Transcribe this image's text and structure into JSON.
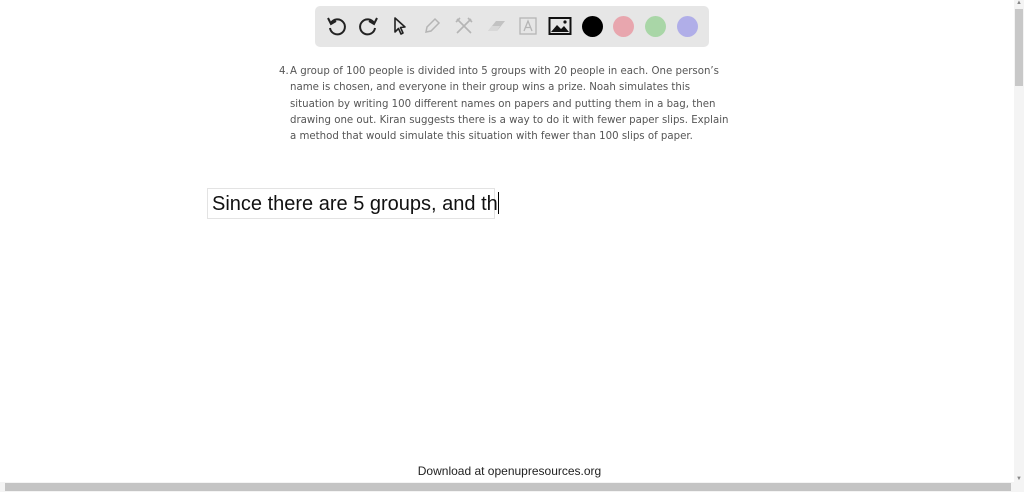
{
  "toolbar": {
    "tools": [
      "undo-icon",
      "redo-icon",
      "select-pointer-icon",
      "pencil-icon",
      "tools-icon",
      "eraser-icon",
      "text-box-icon",
      "image-icon"
    ],
    "colors": [
      "#000000",
      "#e8a6ae",
      "#a9d6a7",
      "#b0aee8"
    ]
  },
  "problem": {
    "number": "4.",
    "text": "A group of 100 people is divided into 5 groups with 20 people in each. One person’s name is chosen, and everyone in their group wins a prize. Noah simulates this situation by writing 100 different names on papers and putting them in a bag, then drawing one out. Kiran suggests there is a way to do it with fewer paper slips. Explain a method that would simulate this situation with fewer than 100 slips of paper."
  },
  "answer": {
    "value": "Since there are 5 groups, and th"
  },
  "footer": {
    "text": "Download at openupresources.org"
  }
}
